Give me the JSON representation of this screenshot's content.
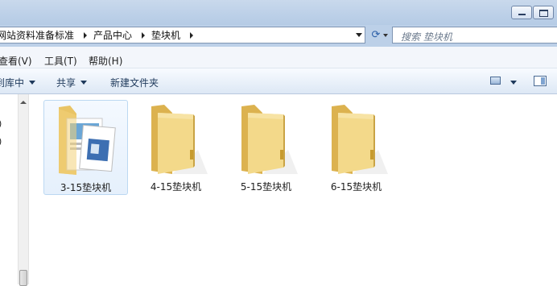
{
  "address": {
    "crumbs": [
      "网站资料准备标准",
      "产品中心",
      "垫块机"
    ]
  },
  "search": {
    "placeholder": "搜索 垫块机"
  },
  "menu": {
    "items": [
      "查看(V)",
      "工具(T)",
      "帮助(H)"
    ]
  },
  "toolbar": {
    "include_library": "到库中",
    "share": "共享",
    "new_folder": "新建文件夹"
  },
  "nav_pane": {
    "fragments": [
      ")",
      ")"
    ]
  },
  "folders": [
    {
      "name": "3-15垫块机",
      "selected": true,
      "has_contents": true
    },
    {
      "name": "4-15垫块机",
      "selected": false,
      "has_contents": false
    },
    {
      "name": "5-15垫块机",
      "selected": false,
      "has_contents": false
    },
    {
      "name": "6-15垫块机",
      "selected": false,
      "has_contents": false
    }
  ],
  "colors": {
    "folder": "#f2d27a",
    "folder_dark": "#d9b04c",
    "selection": "#e5f0fc",
    "chrome": "#bcd0e8"
  }
}
